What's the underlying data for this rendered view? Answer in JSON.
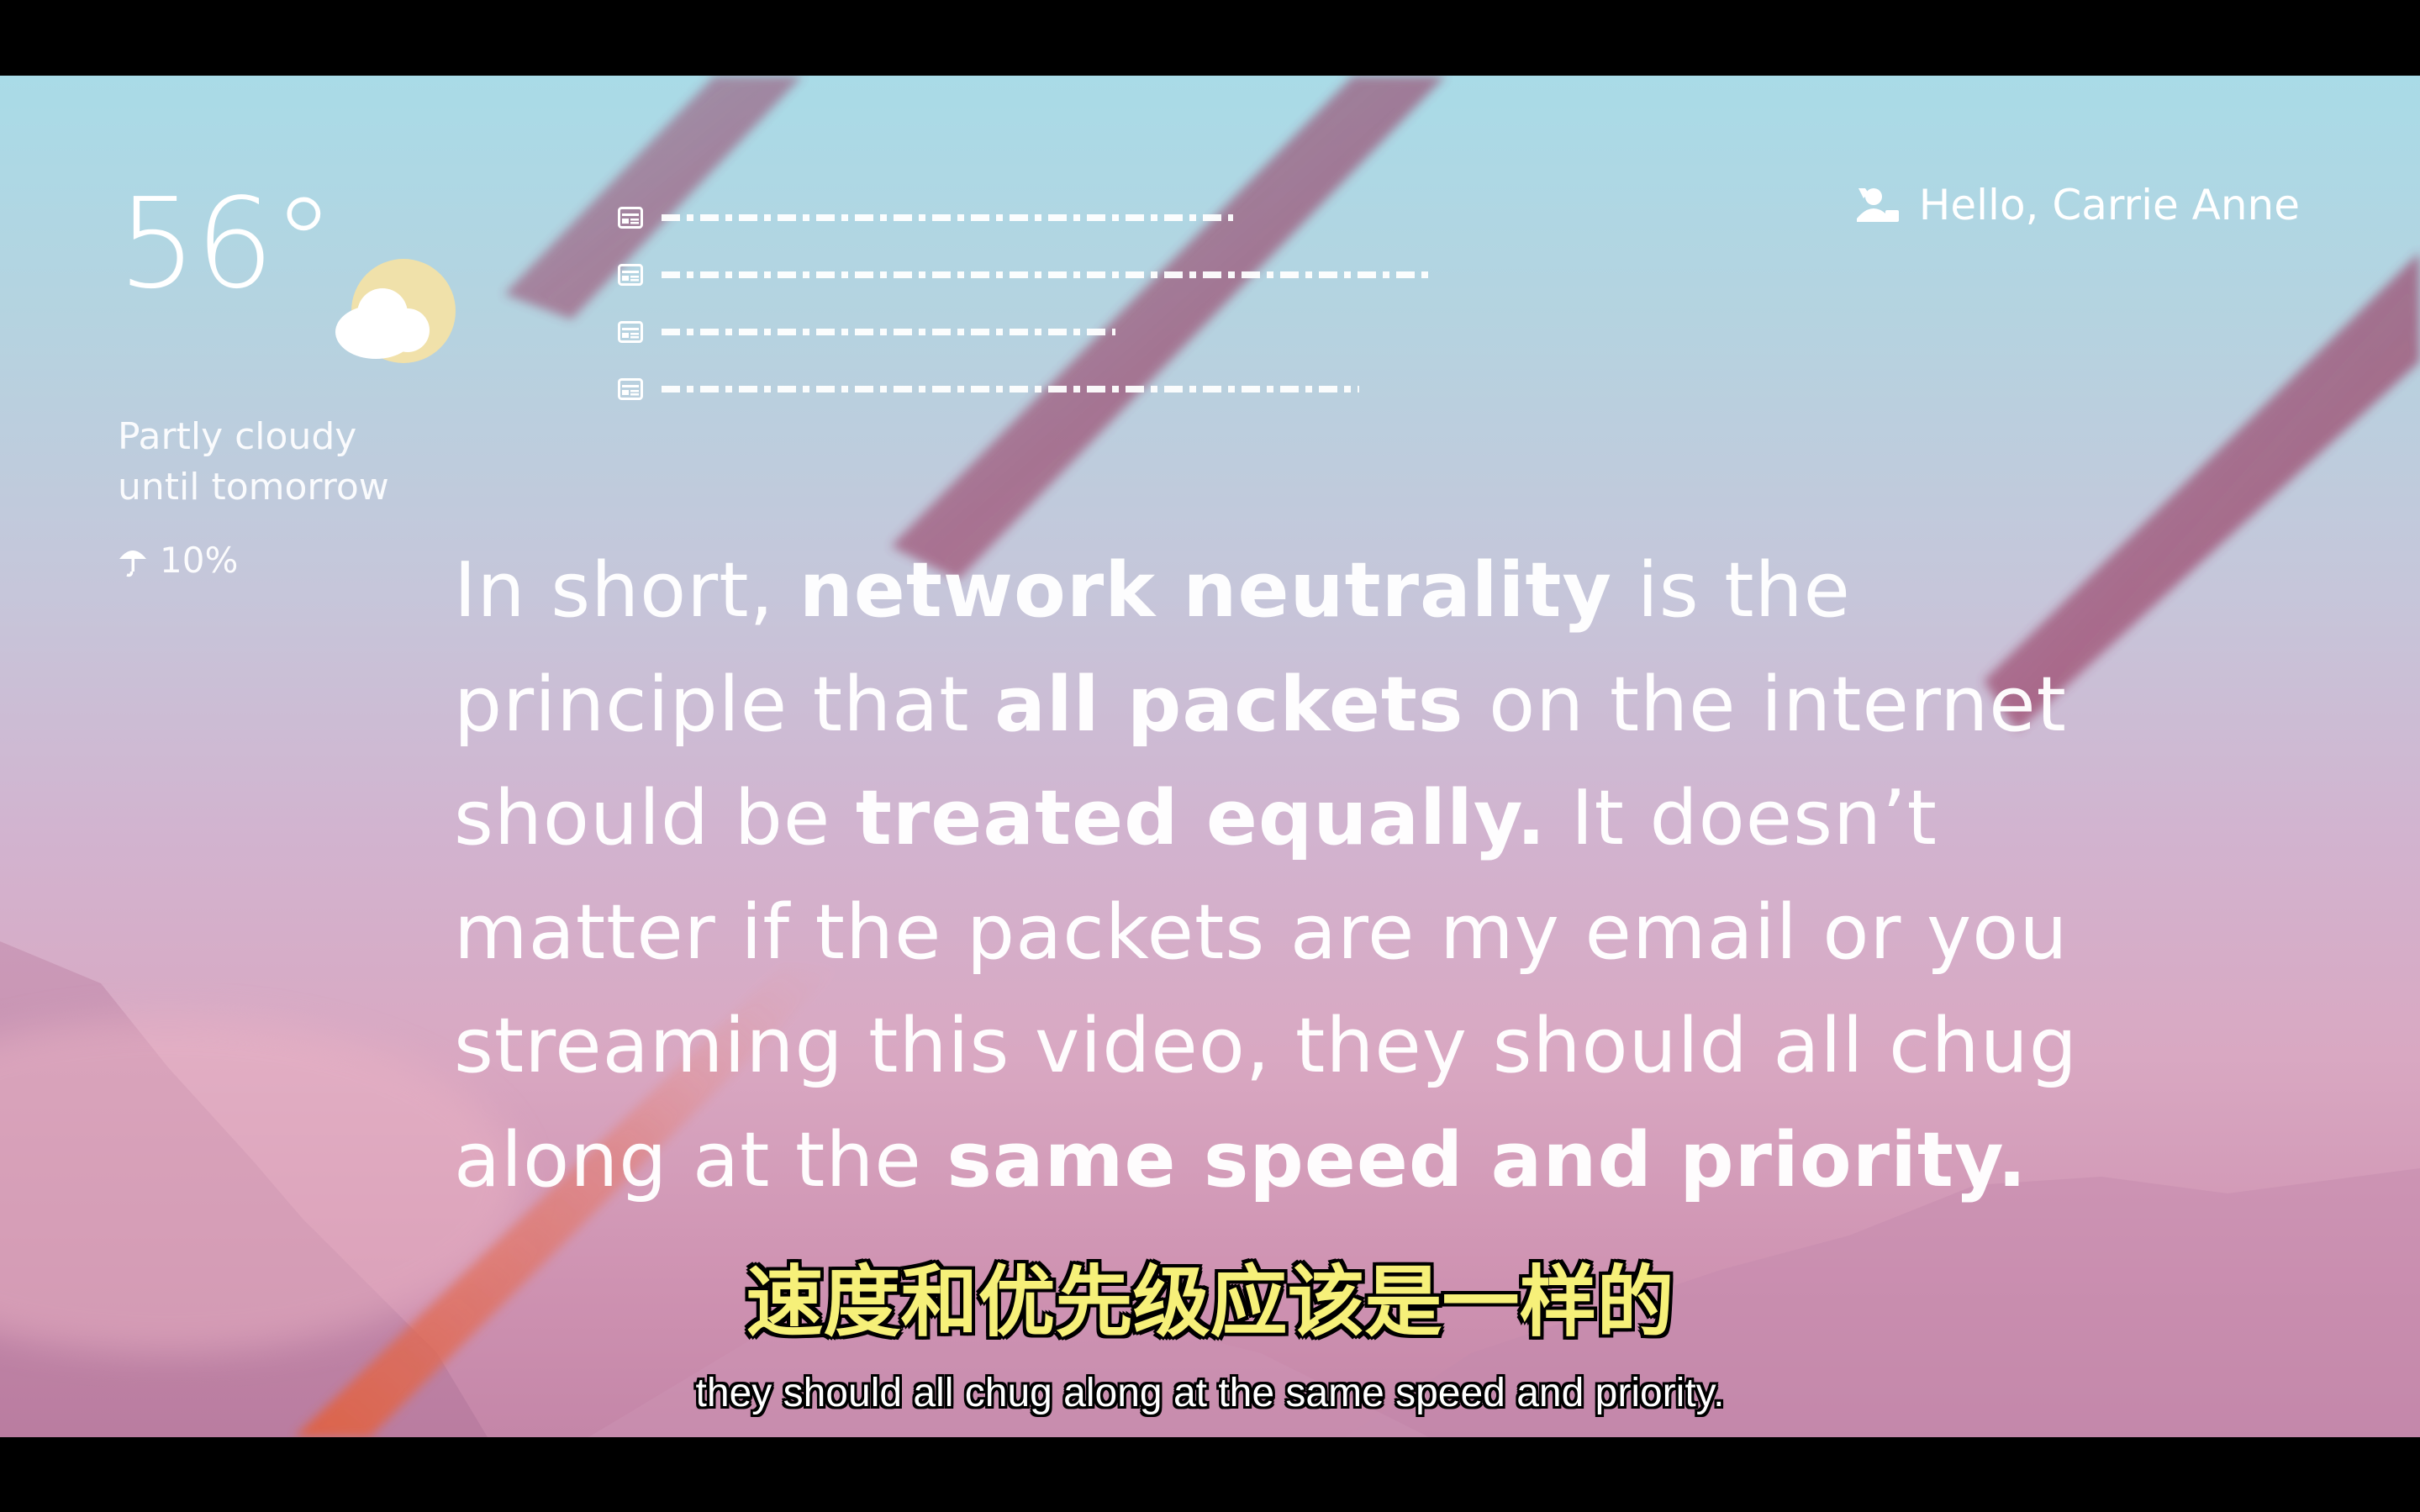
{
  "weather": {
    "temperature": "56°",
    "condition_line1": "Partly cloudy",
    "condition_line2": "until tomorrow",
    "precipitation": "10%",
    "weather_icon": "partly-cloudy-icon",
    "precip_icon": "umbrella-icon"
  },
  "greeting": {
    "text": "Hello, Carrie Anne",
    "icon": "user-icon"
  },
  "news": {
    "icon": "news-icon",
    "items": [
      {
        "placeholder": "redacted headline"
      },
      {
        "placeholder": "redacted headline"
      },
      {
        "placeholder": "redacted headline"
      },
      {
        "placeholder": "redacted headline"
      }
    ]
  },
  "statement": {
    "l1_a": "In short, ",
    "l1_b": "network neutrality",
    "l1_c": " is the",
    "l2_a": "principle that ",
    "l2_b": "all packets",
    "l2_c": " on the internet",
    "l3_a": "should be ",
    "l3_b": "treated equally.",
    "l3_c": " It doesn’t",
    "l4": "matter if the packets are my email or you",
    "l5": "streaming this video, they should all chug",
    "l6_a": "along at the ",
    "l6_b": "same speed and priority."
  },
  "subtitles": {
    "chinese": "速度和优先级应该是一样的",
    "english": "they should all chug along at the same speed and priority."
  },
  "colors": {
    "sky_top": "#a9dbe7",
    "sky_bottom": "#c486a8",
    "streak": "#a2446a",
    "streak_warm": "#e0603f",
    "subtitle_cn": "#f6f079",
    "text": "#ffffff"
  }
}
